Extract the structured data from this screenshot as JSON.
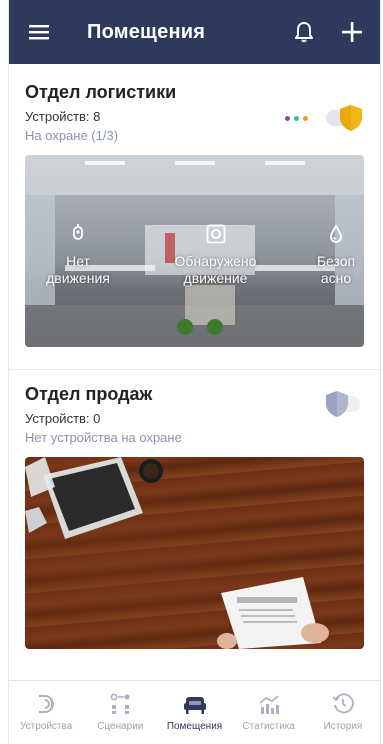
{
  "appbar": {
    "title": "Помещения",
    "menu_icon": "menu-icon",
    "bell_icon": "bell-icon",
    "add_icon": "plus-icon"
  },
  "colors": {
    "brand": "#2d3a5c",
    "shield_armed": "#f2b418",
    "shield_off": "#9aa3c0",
    "dot1": "#8e44ad",
    "dot2": "#2ecc71",
    "dot3": "#f39c12"
  },
  "rooms": [
    {
      "title": "Отдел логистики",
      "devices": "Устройств: 8",
      "status": "На охране (1/3)",
      "armed": true,
      "sensors": [
        {
          "icon": "motion-sensor-icon",
          "label_line1": "Нет",
          "label_line2": "движения"
        },
        {
          "icon": "camera-sensor-icon",
          "label_line1": "Обнаружено",
          "label_line2": "движение"
        },
        {
          "icon": "leak-sensor-icon",
          "label_line1": "Безоп",
          "label_line2": "асно"
        }
      ]
    },
    {
      "title": "Отдел продаж",
      "devices": "Устройств: 0",
      "status": "Нет устройства на охране",
      "armed": false
    }
  ],
  "tabs": [
    {
      "label": "Устройства",
      "icon": "devices-icon",
      "active": false
    },
    {
      "label": "Сценарии",
      "icon": "scenarios-icon",
      "active": false
    },
    {
      "label": "Помещения",
      "icon": "rooms-icon",
      "active": true
    },
    {
      "label": "Статистика",
      "icon": "statistics-icon",
      "active": false
    },
    {
      "label": "История",
      "icon": "history-icon",
      "active": false
    }
  ]
}
